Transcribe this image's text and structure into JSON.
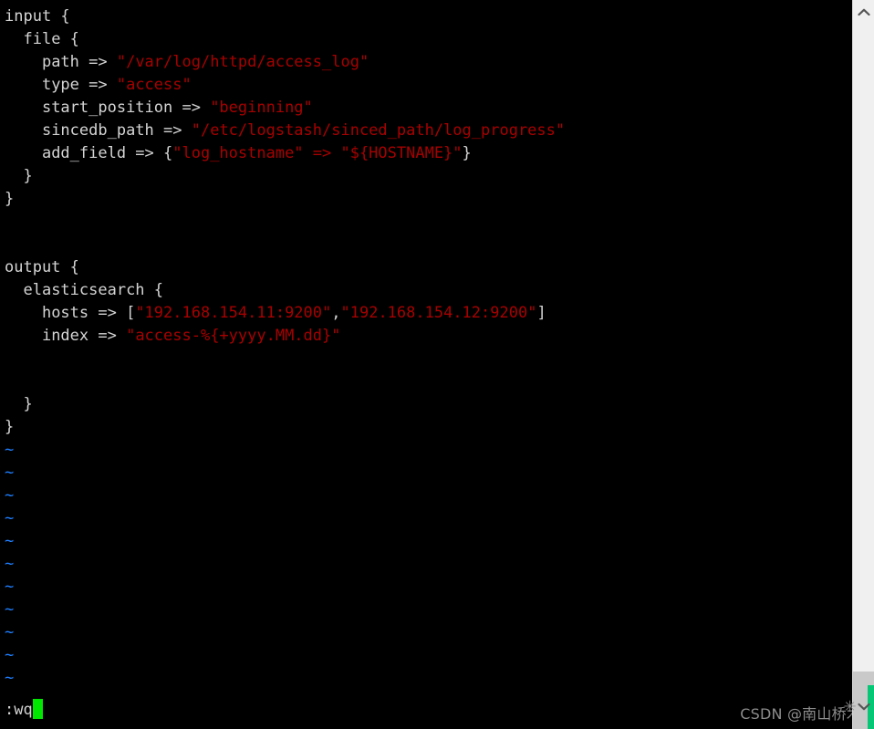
{
  "app": {
    "name": "vim",
    "background_color": "#000000",
    "foreground_color": "#d4d4d4",
    "string_color": "#a80000",
    "tilde_color": "#1f7fff",
    "cursor_color": "#00e800"
  },
  "editor": {
    "lines": [
      {
        "n": 1,
        "indent": 0,
        "tokens": [
          {
            "t": "input {",
            "c": "k"
          }
        ]
      },
      {
        "n": 2,
        "indent": 1,
        "tokens": [
          {
            "t": "file {",
            "c": "k"
          }
        ]
      },
      {
        "n": 3,
        "indent": 2,
        "tokens": [
          {
            "t": "path => ",
            "c": "k"
          },
          {
            "t": "\"/var/log/httpd/access_log\"",
            "c": "s"
          }
        ]
      },
      {
        "n": 4,
        "indent": 2,
        "tokens": [
          {
            "t": "type => ",
            "c": "k"
          },
          {
            "t": "\"access\"",
            "c": "s"
          }
        ]
      },
      {
        "n": 5,
        "indent": 2,
        "tokens": [
          {
            "t": "start_position => ",
            "c": "k"
          },
          {
            "t": "\"beginning\"",
            "c": "s"
          }
        ]
      },
      {
        "n": 6,
        "indent": 2,
        "tokens": [
          {
            "t": "sincedb_path => ",
            "c": "k"
          },
          {
            "t": "\"/etc/logstash/sinced_path/log_progress\"",
            "c": "s"
          }
        ]
      },
      {
        "n": 7,
        "indent": 2,
        "tokens": [
          {
            "t": "add_field => {",
            "c": "k"
          },
          {
            "t": "\"log_hostname\" => \"${HOSTNAME}\"",
            "c": "s"
          },
          {
            "t": "}",
            "c": "k"
          }
        ]
      },
      {
        "n": 8,
        "indent": 1,
        "tokens": [
          {
            "t": "}",
            "c": "k"
          }
        ]
      },
      {
        "n": 9,
        "indent": 0,
        "tokens": [
          {
            "t": "}",
            "c": "k"
          }
        ]
      },
      {
        "n": 10,
        "indent": 0,
        "tokens": []
      },
      {
        "n": 11,
        "indent": 0,
        "tokens": []
      },
      {
        "n": 12,
        "indent": 0,
        "tokens": [
          {
            "t": "output {",
            "c": "k"
          }
        ]
      },
      {
        "n": 13,
        "indent": 1,
        "tokens": [
          {
            "t": "elasticsearch {",
            "c": "k"
          }
        ]
      },
      {
        "n": 14,
        "indent": 2,
        "tokens": [
          {
            "t": "hosts => [",
            "c": "k"
          },
          {
            "t": "\"192.168.154.11:9200\"",
            "c": "s"
          },
          {
            "t": ",",
            "c": "k"
          },
          {
            "t": "\"192.168.154.12:9200\"",
            "c": "s"
          },
          {
            "t": "]",
            "c": "k"
          }
        ]
      },
      {
        "n": 15,
        "indent": 2,
        "tokens": [
          {
            "t": "index => ",
            "c": "k"
          },
          {
            "t": "\"access-%{+yyyy.MM.dd}\"",
            "c": "s"
          }
        ]
      },
      {
        "n": 16,
        "indent": 0,
        "tokens": []
      },
      {
        "n": 17,
        "indent": 0,
        "tokens": []
      },
      {
        "n": 18,
        "indent": 1,
        "tokens": [
          {
            "t": "}",
            "c": "k"
          }
        ]
      },
      {
        "n": 19,
        "indent": 0,
        "tokens": [
          {
            "t": "}",
            "c": "k"
          }
        ]
      },
      {
        "n": 20,
        "indent": 0,
        "tokens": [
          {
            "t": "~",
            "c": "tilde"
          }
        ]
      },
      {
        "n": 21,
        "indent": 0,
        "tokens": [
          {
            "t": "~",
            "c": "tilde"
          }
        ]
      },
      {
        "n": 22,
        "indent": 0,
        "tokens": [
          {
            "t": "~",
            "c": "tilde"
          }
        ]
      },
      {
        "n": 23,
        "indent": 0,
        "tokens": [
          {
            "t": "~",
            "c": "tilde"
          }
        ]
      },
      {
        "n": 24,
        "indent": 0,
        "tokens": [
          {
            "t": "~",
            "c": "tilde"
          }
        ]
      },
      {
        "n": 25,
        "indent": 0,
        "tokens": [
          {
            "t": "~",
            "c": "tilde"
          }
        ]
      },
      {
        "n": 26,
        "indent": 0,
        "tokens": [
          {
            "t": "~",
            "c": "tilde"
          }
        ]
      },
      {
        "n": 27,
        "indent": 0,
        "tokens": [
          {
            "t": "~",
            "c": "tilde"
          }
        ]
      },
      {
        "n": 28,
        "indent": 0,
        "tokens": [
          {
            "t": "~",
            "c": "tilde"
          }
        ]
      },
      {
        "n": 29,
        "indent": 0,
        "tokens": [
          {
            "t": "~",
            "c": "tilde"
          }
        ]
      },
      {
        "n": 30,
        "indent": 0,
        "tokens": [
          {
            "t": "~",
            "c": "tilde"
          }
        ]
      }
    ]
  },
  "statusline": {
    "command": ":wq",
    "cursor": "block"
  },
  "watermark": {
    "text": "CSDN @南山桥木"
  },
  "scrollbar": {
    "up_arrow": "chevron-up-icon",
    "down_arrow": "chevron-down-icon",
    "thumb_position": "bottom",
    "accent_color": "#06c775",
    "track_color": "#f0f0f0",
    "thumb_color": "#c9c9c9",
    "star_glyph": "✳"
  }
}
